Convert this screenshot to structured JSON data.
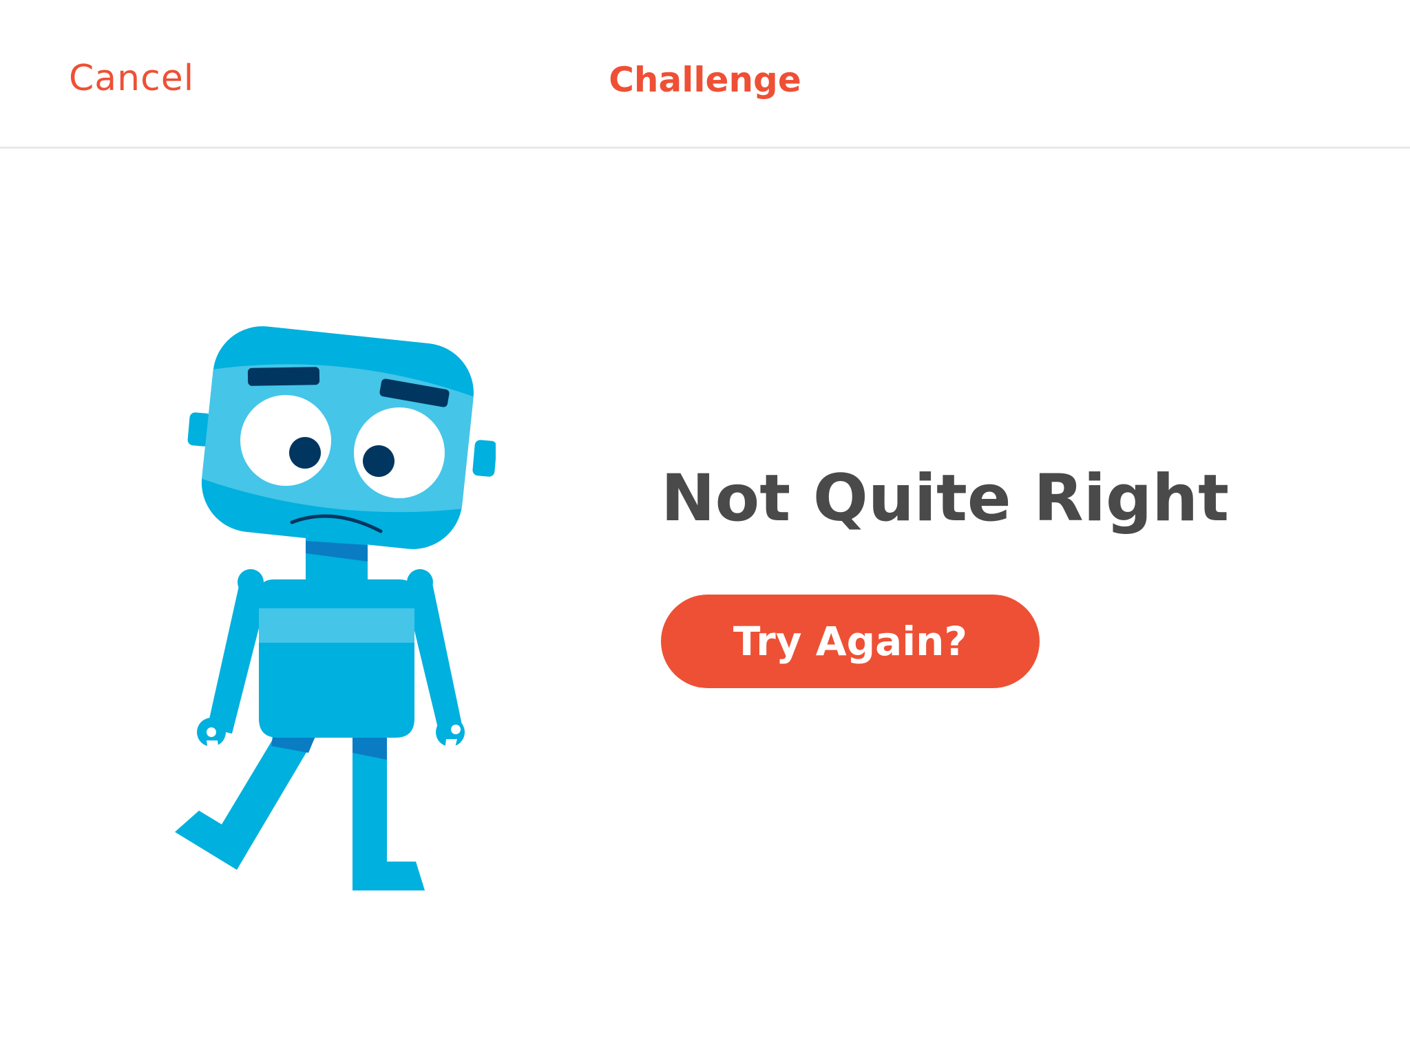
{
  "nav": {
    "cancel_label": "Cancel",
    "title": "Challenge"
  },
  "result": {
    "heading": "Not Quite Right",
    "retry_label": "Try Again?"
  },
  "colors": {
    "accent": "#ee5035",
    "heading_text": "#4a4a4a",
    "robot_blue": "#00b0de",
    "robot_light_blue": "#45c5e8",
    "robot_dark_blue": "#0a7cc4",
    "robot_navy": "#003660"
  },
  "illustration": "sad-robot-icon"
}
